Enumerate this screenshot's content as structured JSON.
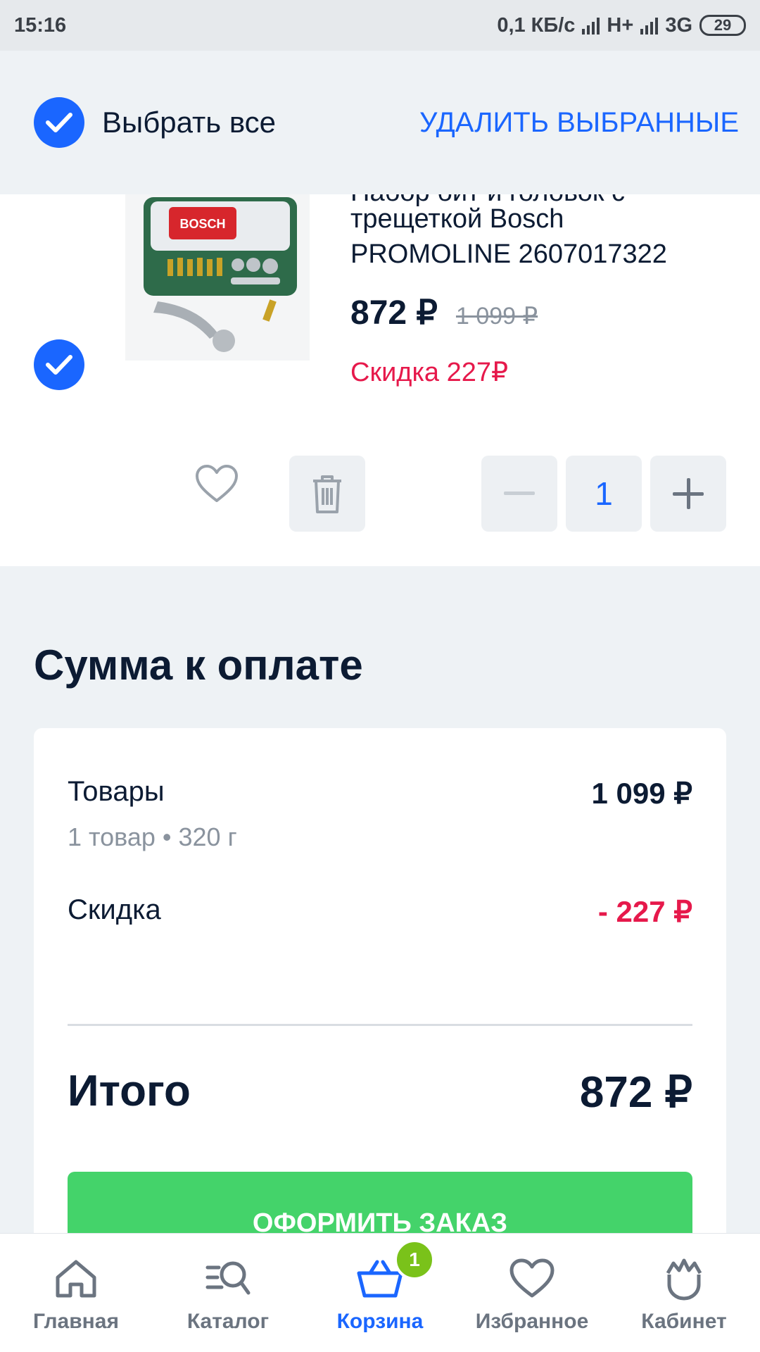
{
  "status_bar": {
    "time": "15:16",
    "speed": "0,1 КБ/с",
    "network1": "H+",
    "network2": "3G",
    "battery": "29"
  },
  "select_bar": {
    "select_all_label": "Выбрать все",
    "delete_selected_label": "УДАЛИТЬ ВЫБРАННЫЕ"
  },
  "product": {
    "title_line_partial": "Набор бит и головок с",
    "title_line1": "трещеткой Bosch",
    "title_line2": "PROMOLINE 2607017322",
    "price": "872 ₽",
    "old_price": "1 099 ₽",
    "discount": "Скидка 227₽",
    "image_brand": "BOSCH",
    "quantity": "1"
  },
  "summary": {
    "heading": "Сумма к оплате",
    "goods_label": "Товары",
    "goods_sub": "1 товар • 320 г",
    "goods_value": "1 099 ₽",
    "discount_label": "Скидка",
    "discount_value": "- 227 ₽",
    "total_label": "Итого",
    "total_value": "872 ₽",
    "checkout_label": "ОФОРМИТЬ ЗАКАЗ"
  },
  "nav": {
    "items": [
      {
        "label": "Главная",
        "icon": "home-icon"
      },
      {
        "label": "Каталог",
        "icon": "catalog-search-icon"
      },
      {
        "label": "Корзина",
        "icon": "cart-icon"
      },
      {
        "label": "Избранное",
        "icon": "heart-icon"
      },
      {
        "label": "Кабинет",
        "icon": "crown-icon"
      }
    ],
    "cart_badge": "1"
  },
  "colors": {
    "accent": "#1a66ff",
    "discount": "#e6194b",
    "checkout": "#44d36a",
    "badge": "#7ac21a"
  }
}
